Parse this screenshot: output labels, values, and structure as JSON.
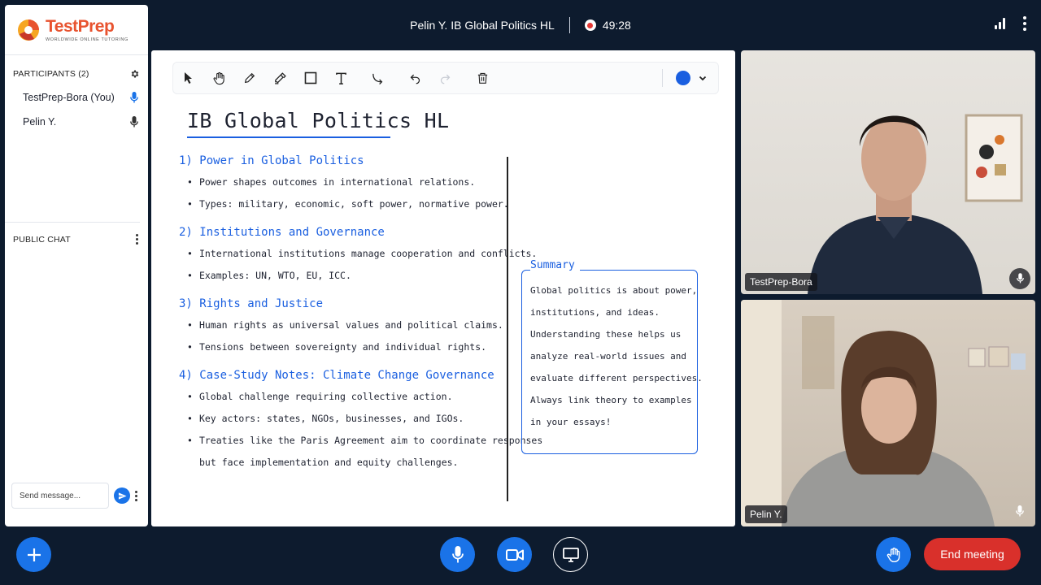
{
  "header": {
    "meeting_title": "Pelin Y. IB Global Politics HL",
    "timer": "49:28"
  },
  "brand": {
    "name": "TestPrep",
    "tagline": "WORLDWIDE ONLINE TUTORING"
  },
  "sidebar": {
    "participants_title": "PARTICIPANTS (2)",
    "participants": [
      {
        "name": "TestPrep-Bora (You)",
        "mic_color": "#1a73e8"
      },
      {
        "name": "Pelin Y.",
        "mic_color": "#333333"
      }
    ],
    "chat_title": "PUBLIC CHAT",
    "chat_placeholder": "Send message..."
  },
  "whiteboard": {
    "toolbar_tools": [
      "pointer-icon",
      "hand-icon",
      "pen-icon",
      "highlighter-icon",
      "rectangle-icon",
      "text-icon",
      "connector-icon",
      "undo-icon",
      "redo-icon",
      "trash-icon"
    ],
    "selected_color": "#1a5fe0",
    "title": "IB Global Politics HL",
    "sections": [
      {
        "heading": "1) Power in Global Politics",
        "bullets": [
          "Power shapes outcomes in international relations.",
          "Types: military, economic, soft power, normative power."
        ]
      },
      {
        "heading": "2) Institutions and Governance",
        "bullets": [
          "International institutions manage cooperation and conflicts.",
          "Examples: UN, WTO, EU, ICC."
        ]
      },
      {
        "heading": "3) Rights and Justice",
        "bullets": [
          "Human rights as universal values and political claims.",
          "Tensions between sovereignty and individual rights."
        ]
      },
      {
        "heading": "4) Case-Study Notes: Climate Change Governance",
        "bullets": [
          "Global challenge requiring collective action.",
          "Key actors: states, NGOs, businesses, and IGOs.",
          "Treaties like the Paris Agreement aim to coordinate responses"
        ],
        "continuation": "but face implementation and equity challenges."
      }
    ],
    "summary": {
      "label": "Summary",
      "lines": [
        "Global politics is about power,",
        "institutions, and ideas.",
        "Understanding these helps us",
        "analyze real-world issues and",
        "evaluate different perspectives.",
        "Always link theory to examples",
        "in your essays!"
      ]
    }
  },
  "videos": [
    {
      "name": "TestPrep-Bora"
    },
    {
      "name": "Pelin Y."
    }
  ],
  "controls": {
    "end_meeting_label": "End meeting",
    "end_color": "#d9302b",
    "accent": "#1a73e8"
  }
}
